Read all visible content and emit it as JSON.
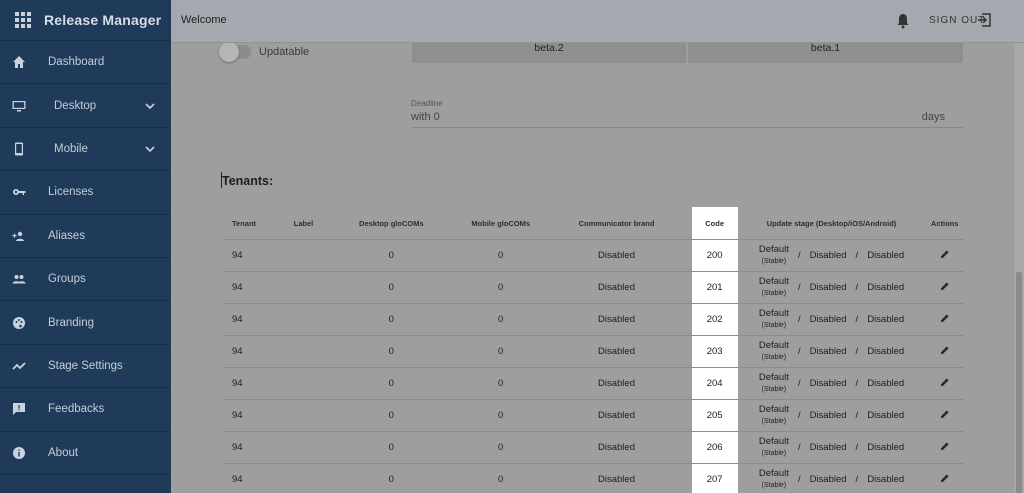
{
  "app": {
    "title": "Release Manager"
  },
  "sidebar": {
    "items": [
      {
        "label": "Dashboard",
        "icon": "home-icon"
      },
      {
        "label": "Desktop",
        "icon": "desktop-icon",
        "expandable": true
      },
      {
        "label": "Mobile",
        "icon": "mobile-icon",
        "expandable": true
      },
      {
        "label": "Licenses",
        "icon": "key-icon"
      },
      {
        "label": "Aliases",
        "icon": "add-group-icon"
      },
      {
        "label": "Groups",
        "icon": "group-icon"
      },
      {
        "label": "Branding",
        "icon": "palette-icon"
      },
      {
        "label": "Stage Settings",
        "icon": "trend-icon"
      },
      {
        "label": "Feedbacks",
        "icon": "feedback-icon"
      },
      {
        "label": "About",
        "icon": "info-icon"
      }
    ]
  },
  "header": {
    "welcome": "Welcome",
    "signout": "SIGN OUT"
  },
  "settings": {
    "updatable_label": "Updatable",
    "beta_left": "beta.2",
    "beta_right": "beta.1",
    "deadline_label": "Deadline",
    "deadline_value": "with 0",
    "deadline_unit": "days"
  },
  "tenants": {
    "heading": "Tenants:",
    "columns": [
      "Tenant",
      "Label",
      "Desktop gloCOMs",
      "Mobile gloCOMs",
      "Communicator brand",
      "Code",
      "Update stage (Desktop/iOS/Android)",
      "Actions"
    ],
    "rows": [
      {
        "tenant": "94",
        "label": "",
        "desktop": "0",
        "mobile": "0",
        "brand": "Disabled",
        "code": "200",
        "stage_default": "Default",
        "stage_note": "(Stable)",
        "stage_ios": "Disabled",
        "stage_android": "Disabled"
      },
      {
        "tenant": "94",
        "label": "",
        "desktop": "0",
        "mobile": "0",
        "brand": "Disabled",
        "code": "201",
        "stage_default": "Default",
        "stage_note": "(Stable)",
        "stage_ios": "Disabled",
        "stage_android": "Disabled"
      },
      {
        "tenant": "94",
        "label": "",
        "desktop": "0",
        "mobile": "0",
        "brand": "Disabled",
        "code": "202",
        "stage_default": "Default",
        "stage_note": "(Stable)",
        "stage_ios": "Disabled",
        "stage_android": "Disabled"
      },
      {
        "tenant": "94",
        "label": "",
        "desktop": "0",
        "mobile": "0",
        "brand": "Disabled",
        "code": "203",
        "stage_default": "Default",
        "stage_note": "(Stable)",
        "stage_ios": "Disabled",
        "stage_android": "Disabled"
      },
      {
        "tenant": "94",
        "label": "",
        "desktop": "0",
        "mobile": "0",
        "brand": "Disabled",
        "code": "204",
        "stage_default": "Default",
        "stage_note": "(Stable)",
        "stage_ios": "Disabled",
        "stage_android": "Disabled"
      },
      {
        "tenant": "94",
        "label": "",
        "desktop": "0",
        "mobile": "0",
        "brand": "Disabled",
        "code": "205",
        "stage_default": "Default",
        "stage_note": "(Stable)",
        "stage_ios": "Disabled",
        "stage_android": "Disabled"
      },
      {
        "tenant": "94",
        "label": "",
        "desktop": "0",
        "mobile": "0",
        "brand": "Disabled",
        "code": "206",
        "stage_default": "Default",
        "stage_note": "(Stable)",
        "stage_ios": "Disabled",
        "stage_android": "Disabled"
      },
      {
        "tenant": "94",
        "label": "",
        "desktop": "0",
        "mobile": "0",
        "brand": "Disabled",
        "code": "207",
        "stage_default": "Default",
        "stage_note": "(Stable)",
        "stage_ios": "Disabled",
        "stage_android": "Disabled"
      }
    ],
    "separator": "/"
  },
  "colors": {
    "sidebar": "#1f3b59",
    "topbar": "#a3a9af",
    "overlay": "#9e9e9e",
    "highlight": "#ffffff"
  }
}
